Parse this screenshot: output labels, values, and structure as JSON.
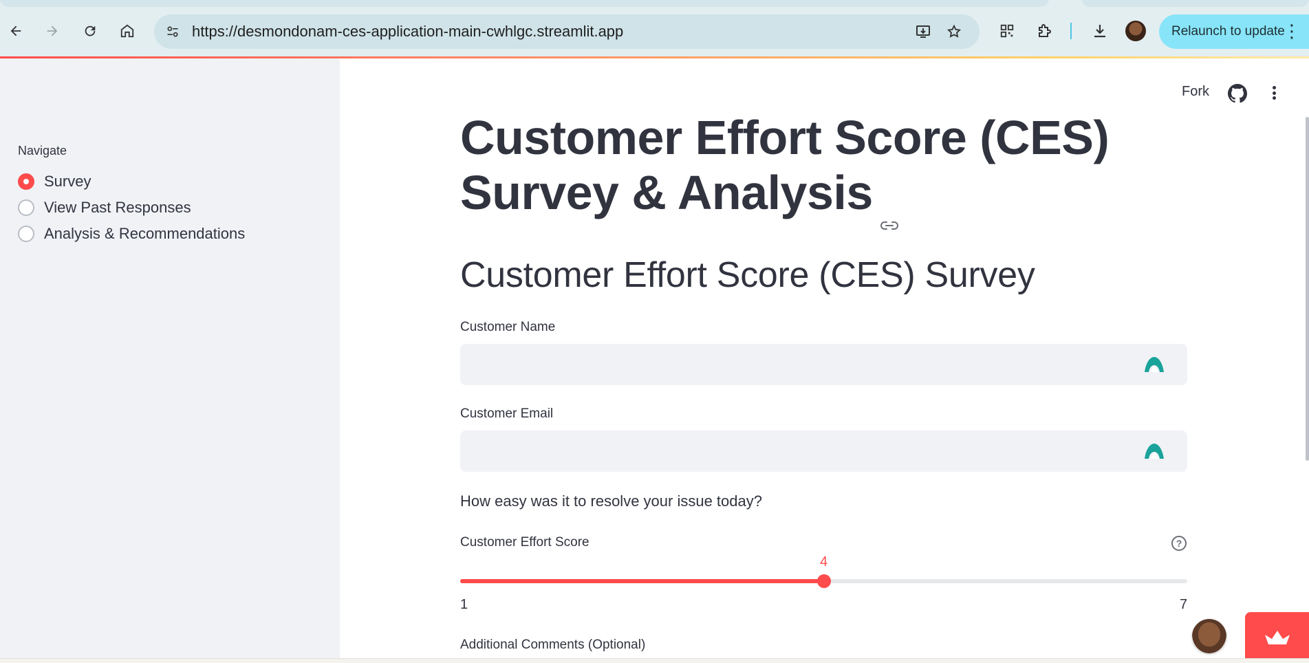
{
  "browser": {
    "url": "https://desmondonam-ces-application-main-cwhlgc.streamlit.app",
    "relaunch_label": "Relaunch to update",
    "icons": [
      "back-icon",
      "forward-icon",
      "reload-icon",
      "home-icon",
      "site-info-icon",
      "install-app-icon",
      "bookmark-star-icon",
      "qr-code-icon",
      "extensions-icon",
      "download-icon",
      "profile-avatar",
      "more-menu-icon"
    ]
  },
  "sidebar": {
    "nav_label": "Navigate",
    "items": [
      {
        "label": "Survey",
        "selected": true
      },
      {
        "label": "View Past Responses",
        "selected": false
      },
      {
        "label": "Analysis & Recommendations",
        "selected": false
      }
    ]
  },
  "header": {
    "fork_label": "Fork"
  },
  "main": {
    "title": "Customer Effort Score (CES) Survey & Analysis",
    "subtitle": "Customer Effort Score (CES) Survey",
    "name_label": "Customer Name",
    "name_value": "",
    "email_label": "Customer Email",
    "email_value": "",
    "question": "How easy was it to resolve your issue today?",
    "slider": {
      "label": "Customer Effort Score",
      "min": 1,
      "max": 7,
      "value": 4,
      "min_label": "1",
      "max_label": "7",
      "value_label": "4"
    },
    "comments_label": "Additional Comments (Optional)"
  },
  "colors": {
    "accent": "#ff4b4b",
    "sidebar_bg": "#f0f2f6",
    "text": "#31333f",
    "chrome_bg": "#e3eef1",
    "relaunch_bg": "#88e4f8"
  }
}
